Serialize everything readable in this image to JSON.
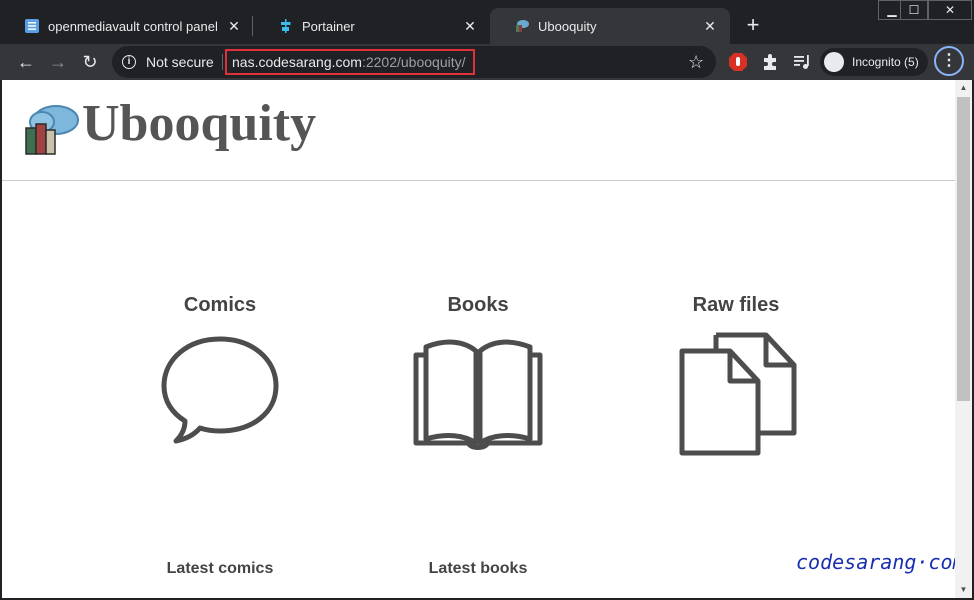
{
  "tabs": [
    {
      "label": "openmediavault control panel - ",
      "icon": "openmediavault-favicon"
    },
    {
      "label": "Portainer",
      "icon": "portainer-favicon"
    },
    {
      "label": "Ubooquity",
      "icon": "ubooquity-favicon",
      "active": true
    }
  ],
  "window_controls": {
    "minimize": "▁",
    "maximize": "☐",
    "close": "✕"
  },
  "toolbar": {
    "security_label": "Not secure",
    "url_host": "nas.codesarang.com",
    "url_path": ":2202/ubooquity/",
    "profile_label": "Incognito (5)"
  },
  "page": {
    "brand": "Ubooquity",
    "sections": [
      {
        "title": "Comics",
        "icon": "speech-bubble-icon"
      },
      {
        "title": "Books",
        "icon": "open-book-icon"
      },
      {
        "title": "Raw files",
        "icon": "files-icon"
      }
    ],
    "latest": [
      "Latest comics",
      "Latest books"
    ],
    "watermark": "codesarang·com"
  },
  "colors": {
    "accent_red": "#e0303b",
    "chrome_dark": "#202124",
    "chrome_toolbar": "#35363a",
    "icon_stroke": "#4d4d4d"
  }
}
